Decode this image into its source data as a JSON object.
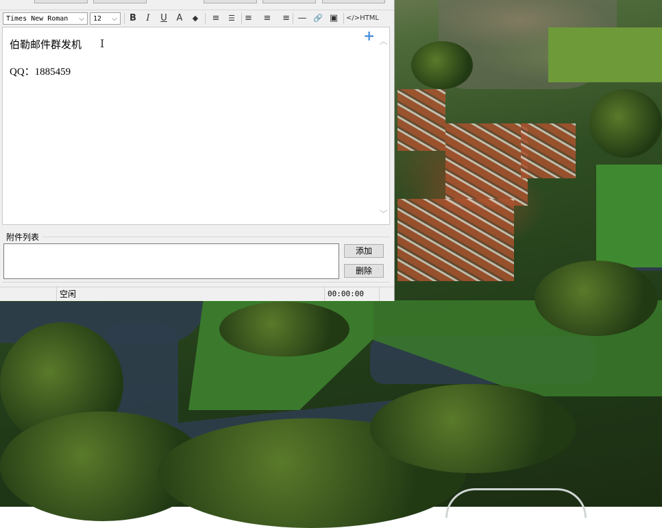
{
  "toolbar": {
    "font_family": "Times New Roman",
    "font_size": "12",
    "dropdown_arrow": "⌵",
    "bold": "B",
    "italic": "I",
    "underline": "U",
    "font_color": "A",
    "highlight": "◆",
    "ordered_list": "≡",
    "unordered_list": "☰",
    "align_left": "≡",
    "align_center": "≡",
    "align_right": "≡",
    "hr": "—",
    "link": "🔗",
    "image": "▣",
    "html_label": "</>HTML"
  },
  "editor": {
    "line1": "伯勒邮件群发机",
    "line2": "QQ：1885459",
    "add_symbol": "+",
    "scroll_up": "︿",
    "scroll_down": "﹀"
  },
  "attachments": {
    "label": "附件列表",
    "add_button": "添加",
    "delete_button": "删除"
  },
  "status": {
    "state": "空闲",
    "timer": "00:00:00"
  }
}
